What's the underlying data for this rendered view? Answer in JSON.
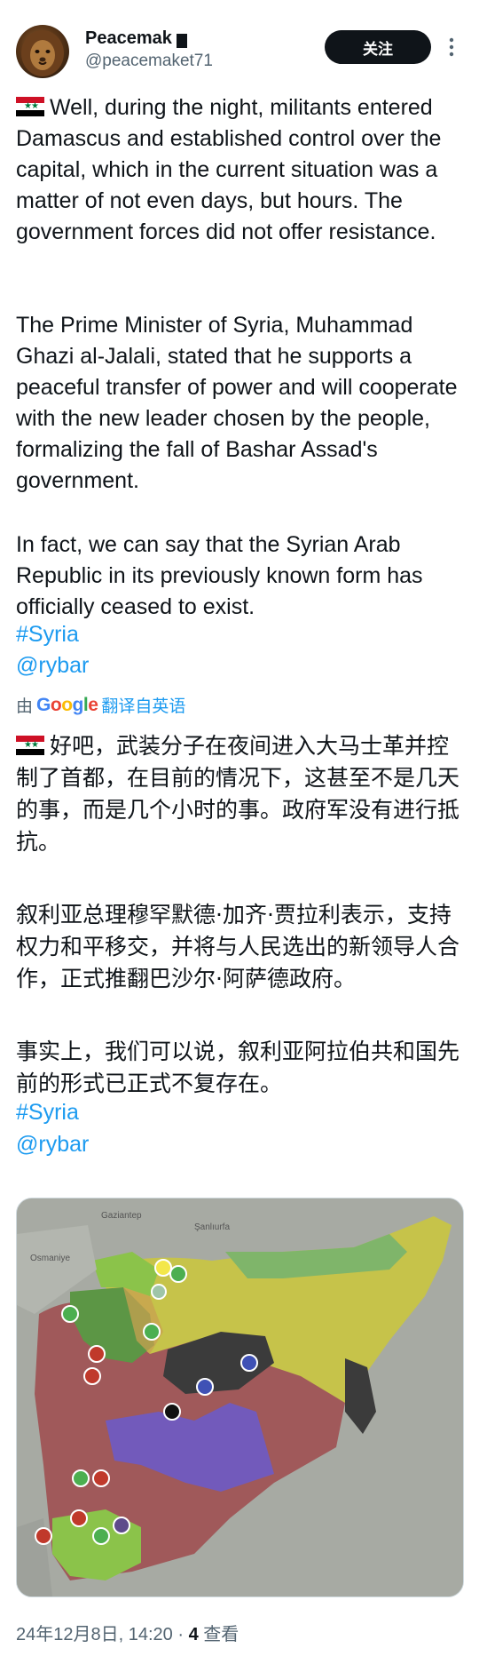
{
  "author": {
    "display_name": "Peacemak",
    "handle": "@peacemaket71",
    "follow_label": "关注"
  },
  "tweet": {
    "original_paragraphs": [
      "Well, during the night, militants entered Damascus and established control over the capital, which in the current situation was a matter of not even days, but hours. The government forces did not offer resistance.",
      "The Prime Minister of Syria, Muhammad Ghazi al-Jalali, stated that he supports a peaceful transfer of power and will cooperate with the new leader chosen by the people, formalizing the fall of Bashar Assad's government.",
      "In fact, we can say that the Syrian Arab Republic in its previously known form has officially ceased to exist."
    ],
    "hashtag": "#Syria",
    "mention": "@rybar"
  },
  "translation": {
    "by_prefix": "由",
    "brand": "Google",
    "label": "翻译自英语",
    "paragraphs": [
      "好吧，武装分子在夜间进入大马士革并控制了首都，在目前的情况下，这甚至不是几天的事，而是几个小时的事。政府军没有进行抵抗。",
      "叙利亚总理穆罕默德·加齐·贾拉利表示，支持权力和平移交，并将与人民选出的新领导人合作，正式推翻巴沙尔·阿萨德政府。",
      "事实上，我们可以说，叙利亚阿拉伯共和国先前的形式已正式不复存在。"
    ],
    "hashtag": "#Syria",
    "mention": "@rybar"
  },
  "map": {
    "city_labels": [
      "Gaziantep",
      "Osmaniye",
      "Şanlıurfa"
    ],
    "colors": {
      "government": "#a0595a",
      "kurdish": "#c6c34a",
      "hts_green": "#5c9645",
      "turkish_backed": "#8bc34a",
      "isis": "#3b3b3b",
      "us_backed": "#6a5acd"
    }
  },
  "meta": {
    "timestamp": "24年12月8日, 14:20",
    "separator": "·",
    "views_count": "4",
    "views_label": "查看"
  },
  "icons": {
    "more": "more-vertical-icon",
    "avatar": "lion-avatar"
  }
}
